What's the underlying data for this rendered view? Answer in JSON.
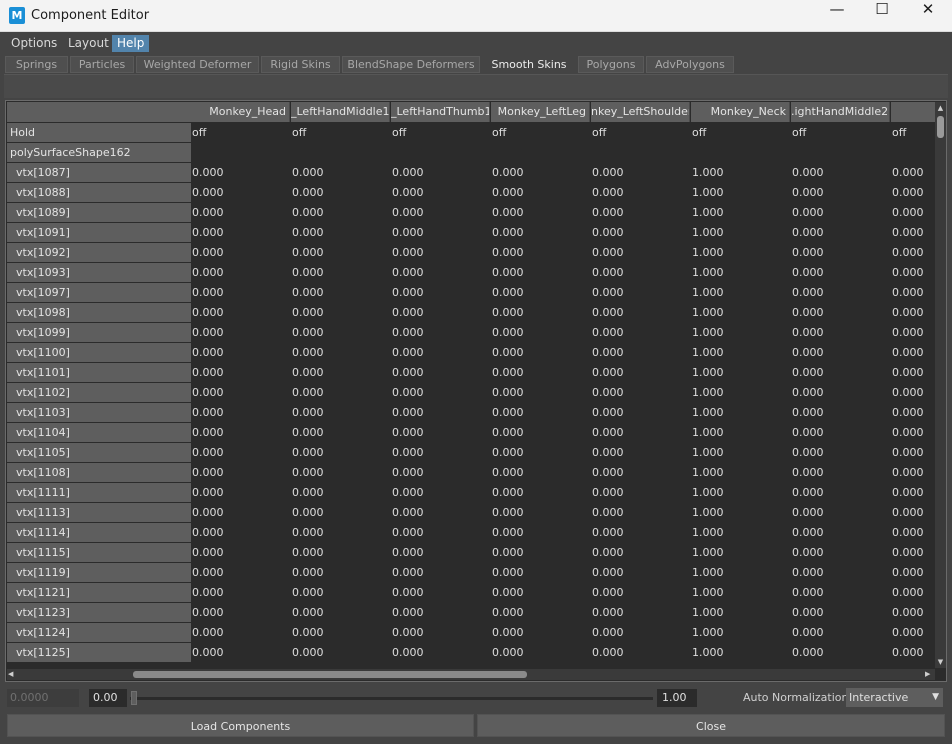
{
  "window": {
    "title": "Component Editor",
    "icon_label": "M",
    "minimize": "—",
    "maximize": "☐",
    "close": "✕"
  },
  "menus": [
    {
      "label": "Options",
      "active": false
    },
    {
      "label": "Layout",
      "active": false
    },
    {
      "label": "Help",
      "active": true
    }
  ],
  "tabs": [
    {
      "label": "Springs",
      "active": false
    },
    {
      "label": "Particles",
      "active": false
    },
    {
      "label": "Weighted Deformer",
      "active": false
    },
    {
      "label": "Rigid Skins",
      "active": false
    },
    {
      "label": "BlendShape Deformers",
      "active": false
    },
    {
      "label": "Smooth Skins",
      "active": true
    },
    {
      "label": "Polygons",
      "active": false
    },
    {
      "label": "AdvPolygons",
      "active": false
    }
  ],
  "grid": {
    "columns": [
      "Monkey_Head",
      "_LeftHandMiddle1",
      "_LeftHandThumb1",
      "Monkey_LeftLeg",
      "nkey_LeftShoulder",
      "Monkey_Neck",
      ".ightHandMiddle2",
      ".ightHan"
    ],
    "hold_label": "Hold",
    "hold_values": [
      "off",
      "off",
      "off",
      "off",
      "off",
      "off",
      "off",
      "off"
    ],
    "group_label": "polySurfaceShape162",
    "rows": [
      {
        "label": "vtx[1087]",
        "values": [
          "0.000",
          "0.000",
          "0.000",
          "0.000",
          "0.000",
          "1.000",
          "0.000",
          "0.000"
        ]
      },
      {
        "label": "vtx[1088]",
        "values": [
          "0.000",
          "0.000",
          "0.000",
          "0.000",
          "0.000",
          "1.000",
          "0.000",
          "0.000"
        ]
      },
      {
        "label": "vtx[1089]",
        "values": [
          "0.000",
          "0.000",
          "0.000",
          "0.000",
          "0.000",
          "1.000",
          "0.000",
          "0.000"
        ]
      },
      {
        "label": "vtx[1091]",
        "values": [
          "0.000",
          "0.000",
          "0.000",
          "0.000",
          "0.000",
          "1.000",
          "0.000",
          "0.000"
        ]
      },
      {
        "label": "vtx[1092]",
        "values": [
          "0.000",
          "0.000",
          "0.000",
          "0.000",
          "0.000",
          "1.000",
          "0.000",
          "0.000"
        ]
      },
      {
        "label": "vtx[1093]",
        "values": [
          "0.000",
          "0.000",
          "0.000",
          "0.000",
          "0.000",
          "1.000",
          "0.000",
          "0.000"
        ]
      },
      {
        "label": "vtx[1097]",
        "values": [
          "0.000",
          "0.000",
          "0.000",
          "0.000",
          "0.000",
          "1.000",
          "0.000",
          "0.000"
        ]
      },
      {
        "label": "vtx[1098]",
        "values": [
          "0.000",
          "0.000",
          "0.000",
          "0.000",
          "0.000",
          "1.000",
          "0.000",
          "0.000"
        ]
      },
      {
        "label": "vtx[1099]",
        "values": [
          "0.000",
          "0.000",
          "0.000",
          "0.000",
          "0.000",
          "1.000",
          "0.000",
          "0.000"
        ]
      },
      {
        "label": "vtx[1100]",
        "values": [
          "0.000",
          "0.000",
          "0.000",
          "0.000",
          "0.000",
          "1.000",
          "0.000",
          "0.000"
        ]
      },
      {
        "label": "vtx[1101]",
        "values": [
          "0.000",
          "0.000",
          "0.000",
          "0.000",
          "0.000",
          "1.000",
          "0.000",
          "0.000"
        ]
      },
      {
        "label": "vtx[1102]",
        "values": [
          "0.000",
          "0.000",
          "0.000",
          "0.000",
          "0.000",
          "1.000",
          "0.000",
          "0.000"
        ]
      },
      {
        "label": "vtx[1103]",
        "values": [
          "0.000",
          "0.000",
          "0.000",
          "0.000",
          "0.000",
          "1.000",
          "0.000",
          "0.000"
        ]
      },
      {
        "label": "vtx[1104]",
        "values": [
          "0.000",
          "0.000",
          "0.000",
          "0.000",
          "0.000",
          "1.000",
          "0.000",
          "0.000"
        ]
      },
      {
        "label": "vtx[1105]",
        "values": [
          "0.000",
          "0.000",
          "0.000",
          "0.000",
          "0.000",
          "1.000",
          "0.000",
          "0.000"
        ]
      },
      {
        "label": "vtx[1108]",
        "values": [
          "0.000",
          "0.000",
          "0.000",
          "0.000",
          "0.000",
          "1.000",
          "0.000",
          "0.000"
        ]
      },
      {
        "label": "vtx[1111]",
        "values": [
          "0.000",
          "0.000",
          "0.000",
          "0.000",
          "0.000",
          "1.000",
          "0.000",
          "0.000"
        ]
      },
      {
        "label": "vtx[1113]",
        "values": [
          "0.000",
          "0.000",
          "0.000",
          "0.000",
          "0.000",
          "1.000",
          "0.000",
          "0.000"
        ]
      },
      {
        "label": "vtx[1114]",
        "values": [
          "0.000",
          "0.000",
          "0.000",
          "0.000",
          "0.000",
          "1.000",
          "0.000",
          "0.000"
        ]
      },
      {
        "label": "vtx[1115]",
        "values": [
          "0.000",
          "0.000",
          "0.000",
          "0.000",
          "0.000",
          "1.000",
          "0.000",
          "0.000"
        ]
      },
      {
        "label": "vtx[1119]",
        "values": [
          "0.000",
          "0.000",
          "0.000",
          "0.000",
          "0.000",
          "1.000",
          "0.000",
          "0.000"
        ]
      },
      {
        "label": "vtx[1121]",
        "values": [
          "0.000",
          "0.000",
          "0.000",
          "0.000",
          "0.000",
          "1.000",
          "0.000",
          "0.000"
        ]
      },
      {
        "label": "vtx[1123]",
        "values": [
          "0.000",
          "0.000",
          "0.000",
          "0.000",
          "0.000",
          "1.000",
          "0.000",
          "0.000"
        ]
      },
      {
        "label": "vtx[1124]",
        "values": [
          "0.000",
          "0.000",
          "0.000",
          "0.000",
          "0.000",
          "1.000",
          "0.000",
          "0.000"
        ]
      },
      {
        "label": "vtx[1125]",
        "values": [
          "0.000",
          "0.000",
          "0.000",
          "0.000",
          "0.000",
          "1.000",
          "0.000",
          "0.000"
        ]
      }
    ]
  },
  "bottom": {
    "min_value": "0.0000",
    "slider_min": "0.00",
    "slider_max": "1.00",
    "slider_level": 0.0,
    "auto_normalization_label": "Auto Normalization",
    "auto_normalization_value": "Interactive",
    "load_components": "Load Components",
    "close": "Close"
  },
  "colors": {
    "accent": "#5284ac",
    "background": "#444444",
    "cell_background": "#2b2b2b",
    "header_background": "#5e5e5e"
  }
}
